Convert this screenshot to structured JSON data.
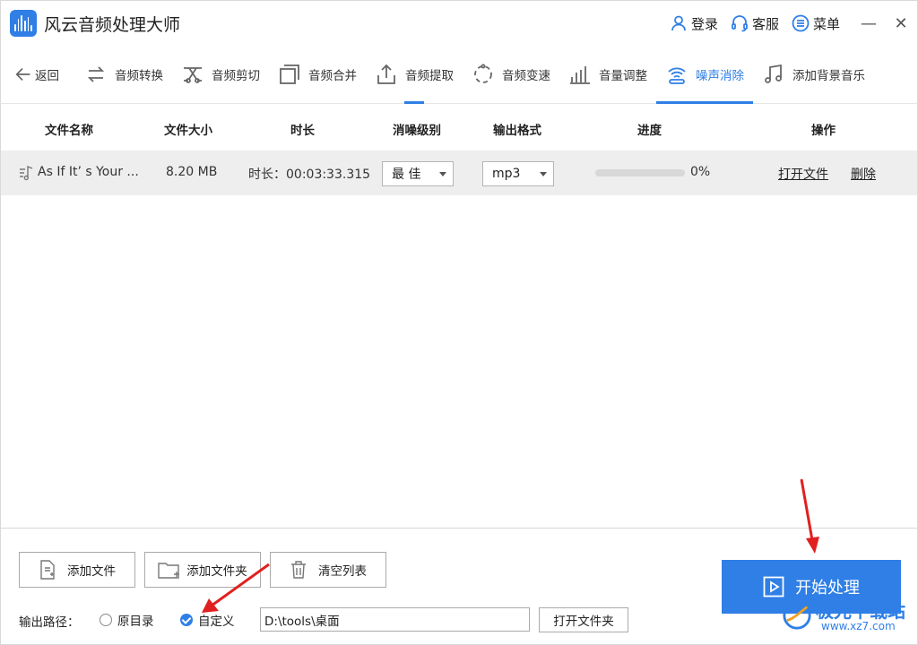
{
  "app": {
    "title": "风云音频处理大师"
  },
  "header": {
    "login": "登录",
    "service": "客服",
    "menu": "菜单",
    "minimize": "—",
    "close": "✕"
  },
  "toolbar": {
    "back": "返回",
    "items": [
      "音频转换",
      "音频剪切",
      "音频合并",
      "音频提取",
      "音频变速",
      "音量调整",
      "噪声消除",
      "添加背景音乐"
    ],
    "active_index": 6
  },
  "table": {
    "headers": [
      "文件名称",
      "文件大小",
      "时长",
      "消噪级别",
      "输出格式",
      "进度",
      "操作"
    ],
    "rows": [
      {
        "name": "As If It’ s Your ...",
        "size": "8.20 MB",
        "duration": "时长：00:03:33.315",
        "noise_level": "最 佳",
        "format": "mp3",
        "progress": 0,
        "progress_text": "0%",
        "open_file": "打开文件",
        "delete": "删除"
      }
    ]
  },
  "bottom": {
    "add_file": "添加文件",
    "add_folder": "添加文件夹",
    "clear_list": "清空列表",
    "output_label": "输出路径：",
    "radio_original": "原目录",
    "radio_custom": "自定义",
    "path": "D:\\tools\\桌面",
    "open_folder": "打开文件夹",
    "start": "开始处理"
  },
  "watermark": {
    "name": "极光下载站",
    "url": "www.xz7.com"
  },
  "colors": {
    "accent": "#2f7fe6",
    "annotation": "#e02020",
    "row_bg": "#eeeeee"
  }
}
